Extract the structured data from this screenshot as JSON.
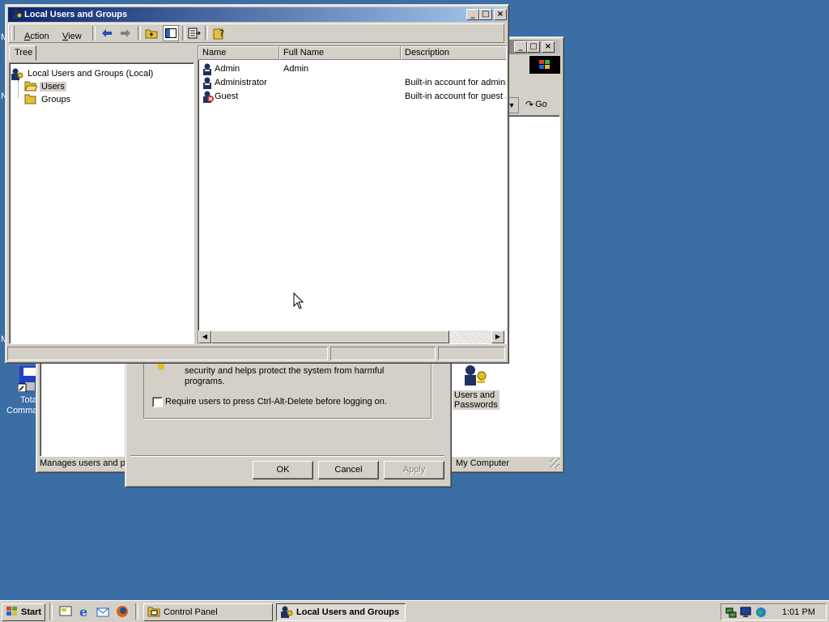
{
  "desktop": {
    "icons": [
      {
        "label_line1": "Tota",
        "label_line2": "Comma"
      }
    ],
    "edge_letters": [
      "M",
      "N",
      "M"
    ]
  },
  "control_panel_window": {
    "status_left": "Manages users and pa",
    "status_right": "My Computer",
    "address_go": "Go",
    "icon_label_line1": "Users and",
    "icon_label_line2": "Passwords"
  },
  "dialog": {
    "text_line1": "security and helps protect the system from harmful",
    "text_line2": "programs.",
    "checkbox_label": "Require users to press Ctrl-Alt-Delete before logging on.",
    "checkbox_checked": false,
    "ok_label": "OK",
    "cancel_label": "Cancel",
    "apply_label": "Apply"
  },
  "main_window": {
    "title": "Local Users and Groups",
    "menu": [
      {
        "label": "Action",
        "accel": "A",
        "rest": "ction"
      },
      {
        "label": "View",
        "accel": "V",
        "rest": "iew"
      }
    ],
    "tree_tab": "Tree",
    "tree": {
      "root": "Local Users and Groups (Local)",
      "children": [
        "Users",
        "Groups"
      ],
      "selected": "Users"
    },
    "columns": [
      "Name",
      "Full Name",
      "Description"
    ],
    "rows": [
      {
        "name": "Admin",
        "full_name": "Admin",
        "description": "",
        "disabled": false
      },
      {
        "name": "Administrator",
        "full_name": "",
        "description": "Built-in account for adminis",
        "disabled": false
      },
      {
        "name": "Guest",
        "full_name": "",
        "description": "Built-in account for guest a",
        "disabled": true
      }
    ]
  },
  "taskbar": {
    "start_label": "Start",
    "tasks": [
      {
        "label": "Control Panel",
        "active": false
      },
      {
        "label": "Local Users and Groups",
        "active": true
      }
    ],
    "clock": "1:01 PM"
  },
  "colors": {
    "desktop": "#3a6ea5",
    "title_active": "#0a246a",
    "face": "#d4d0c8",
    "selection": "#d4d0c8"
  }
}
